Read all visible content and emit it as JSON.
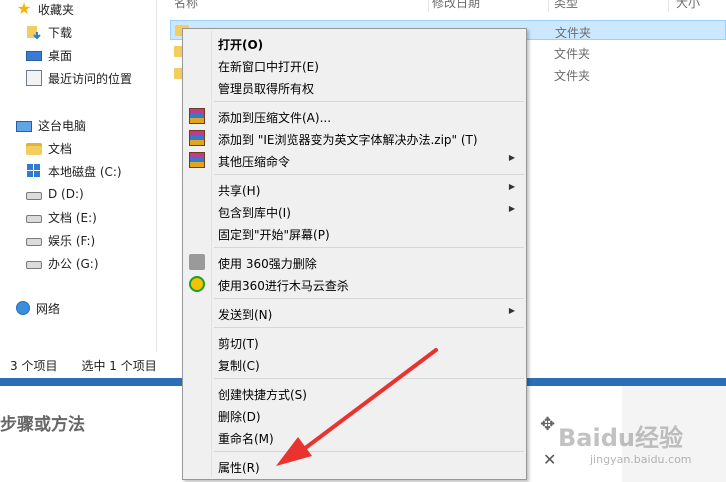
{
  "nav": {
    "favorites": "收藏夹",
    "downloads": "下载",
    "desktop": "桌面",
    "recent": "最近访问的位置",
    "this_pc": "这台电脑",
    "documents": "文档",
    "local_disk": "本地磁盘 (C:)",
    "drive_d": "D (D:)",
    "drive_e": "文档 (E:)",
    "drive_f": "娱乐 (F:)",
    "drive_g": "办公 (G:)",
    "network": "网络"
  },
  "columns": {
    "name": "名称",
    "date": "修改日期",
    "type": "类型",
    "size": "大小"
  },
  "files": [
    {
      "type": "文件夹"
    },
    {
      "type": "文件夹"
    },
    {
      "type": "文件夹"
    }
  ],
  "status": {
    "items": "3 个项目",
    "selected": "选中 1 个项目"
  },
  "context_menu": {
    "open": "打开(O)",
    "open_new_window": "在新窗口中打开(E)",
    "take_ownership": "管理员取得所有权",
    "add_archive": "添加到压缩文件(A)...",
    "add_zip": "添加到 \"IE浏览器变为英文字体解决办法.zip\" (T)",
    "other_compress": "其他压缩命令",
    "share": "共享(H)",
    "include_library": "包含到库中(I)",
    "pin_start": "固定到\"开始\"屏幕(P)",
    "force_delete_360": "使用 360强力删除",
    "scan_360": "使用360进行木马云查杀",
    "send_to": "发送到(N)",
    "cut": "剪切(T)",
    "copy": "复制(C)",
    "create_shortcut": "创建快捷方式(S)",
    "delete": "删除(D)",
    "rename": "重命名(M)",
    "properties": "属性(R)"
  },
  "article": {
    "heading": "步骤或方法"
  },
  "watermark": {
    "brand": "Baidu经验",
    "site": "jingyan.baidu.com"
  },
  "colors": {
    "selection_bg": "#cce8ff",
    "menu_bg": "#f0f0f0",
    "annotation_arrow": "#e8332f",
    "window_frame": "#2a6fb7"
  }
}
